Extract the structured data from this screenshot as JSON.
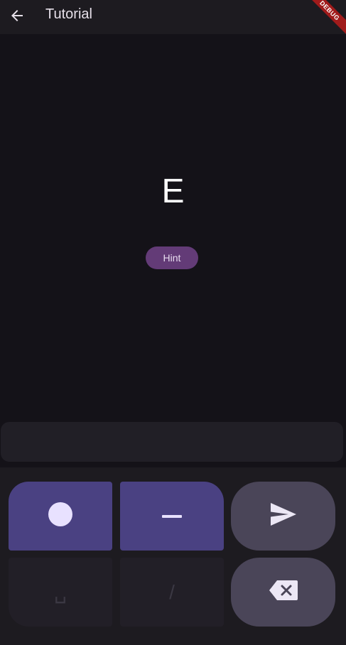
{
  "appbar": {
    "title": "Tutorial",
    "back_icon": "arrow-back-icon"
  },
  "debug_banner": {
    "label": "DEBUG"
  },
  "lesson": {
    "letter": "E",
    "hint_label": "Hint"
  },
  "input": {
    "value": ""
  },
  "keyboard": {
    "keys": [
      {
        "name": "dot",
        "icon": "dot-icon"
      },
      {
        "name": "dash",
        "icon": "dash-icon"
      },
      {
        "name": "send",
        "icon": "send-icon"
      },
      {
        "name": "space",
        "icon": "space-icon",
        "glyph": "␣"
      },
      {
        "name": "slash",
        "icon": "slash-icon",
        "glyph": "/"
      },
      {
        "name": "backspace",
        "icon": "backspace-icon"
      }
    ]
  },
  "colors": {
    "background": "#141218",
    "appbar": "#1d1b20",
    "primary_key": "#4a4182",
    "disabled_key": "#221f27",
    "action_key": "#4a4558",
    "hint_button": "#633b77",
    "debug": "#a01b1b"
  }
}
